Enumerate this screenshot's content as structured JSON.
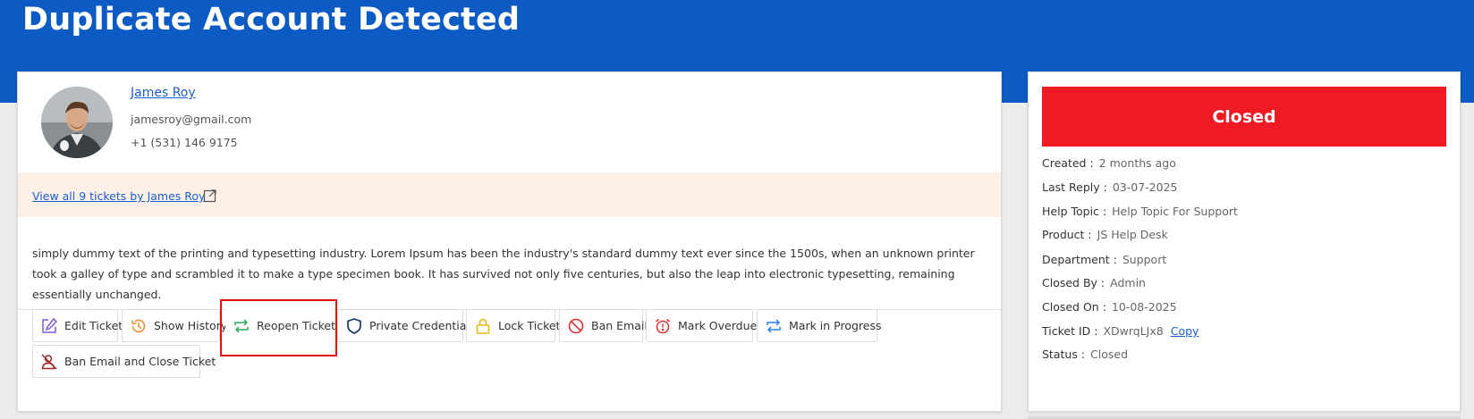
{
  "header": {
    "title": "Duplicate Account Detected"
  },
  "user": {
    "name": "James Roy",
    "email": "jamesroy@gmail.com",
    "phone": "+1 (531) 146 9175"
  },
  "tickets_link": {
    "label": "View all 9 tickets by James Roy"
  },
  "description": "simply dummy text of the printing and typesetting industry. Lorem Ipsum has been the industry's standard dummy text ever since the 1500s, when an unknown printer took a galley of type and scrambled it to make a type specimen book. It has survived not only five centuries, but also the leap into electronic typesetting, remaining essentially unchanged.",
  "actions": [
    {
      "label": "Edit Ticket",
      "icon": "edit-icon",
      "color": "#7b5ad6"
    },
    {
      "label": "Show History",
      "icon": "history-icon",
      "color": "#ef8a2a"
    },
    {
      "label": "Reopen Ticket",
      "icon": "reopen-icon",
      "color": "#27a855"
    },
    {
      "label": "Private Credentials",
      "icon": "shield-icon",
      "color": "#1c3a63"
    },
    {
      "label": "Lock Ticket",
      "icon": "lock-icon",
      "color": "#e6b817"
    },
    {
      "label": "Ban Email",
      "icon": "ban-icon",
      "color": "#e02d2d"
    },
    {
      "label": "Mark Overdue",
      "icon": "alarm-icon",
      "color": "#e02d2d"
    },
    {
      "label": "Mark in Progress",
      "icon": "progress-icon",
      "color": "#2f7fe0"
    },
    {
      "label": "Ban Email and Close Ticket",
      "icon": "ban-user-icon",
      "color": "#a0262a"
    }
  ],
  "status_panel": {
    "status_title": "Closed",
    "status_color": "#ef1a24",
    "rows": [
      {
        "label": "Created :",
        "value": "2 months ago"
      },
      {
        "label": "Last Reply :",
        "value": "03-07-2025"
      },
      {
        "label": "Help Topic :",
        "value": "Help Topic For Support"
      },
      {
        "label": "Product :",
        "value": "JS Help Desk"
      },
      {
        "label": "Department :",
        "value": "Support"
      },
      {
        "label": "Closed By :",
        "value": "Admin"
      },
      {
        "label": "Closed On :",
        "value": "10-08-2025"
      },
      {
        "label": "Ticket ID :",
        "value": "XDwrqLJx8",
        "action": "Copy"
      },
      {
        "label": "Status :",
        "value": "Closed"
      }
    ]
  },
  "colors": {
    "banner": "#0c5bc4",
    "link": "#1a5fd6",
    "highlight": "#e30d0d"
  }
}
